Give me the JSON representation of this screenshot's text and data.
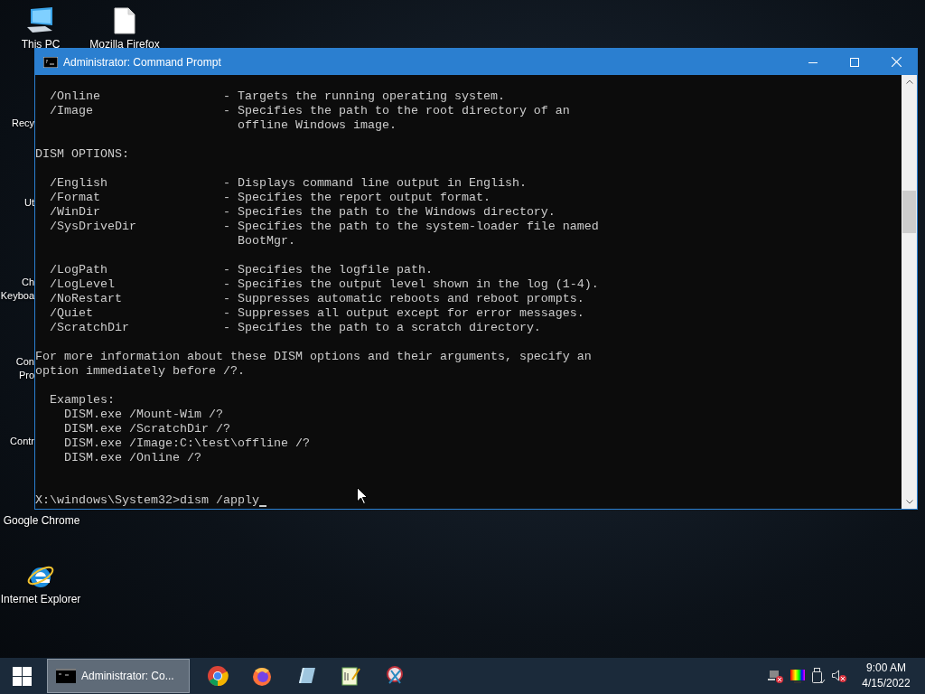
{
  "desktop_icons": [
    {
      "kind": "computer",
      "lines": [
        "This PC"
      ]
    },
    {
      "kind": "file",
      "lines": [
        "Mozilla Firefox"
      ]
    },
    {
      "kind": "hidden",
      "lines": [
        "Recy"
      ]
    },
    {
      "kind": "hidden",
      "lines": [
        "Ut"
      ]
    },
    {
      "kind": "hidden",
      "lines": [
        "Ch",
        "Keyboa"
      ]
    },
    {
      "kind": "hidden",
      "lines": [
        "Con",
        "Pro"
      ]
    },
    {
      "kind": "hidden",
      "lines": [
        "Contr"
      ]
    },
    {
      "kind": "hidden",
      "lines": [
        "Google Chrome"
      ]
    },
    {
      "kind": "ie",
      "lines": [
        "Internet Explorer"
      ]
    }
  ],
  "window": {
    "title": "Administrator: Command Prompt",
    "console_blocks": [
      [
        "  /Online                 - Targets the running operating system.",
        "  /Image                  - Specifies the path to the root directory of an",
        "                            offline Windows image."
      ],
      [
        "DISM OPTIONS:"
      ],
      [
        "  /English                - Displays command line output in English.",
        "  /Format                 - Specifies the report output format.",
        "  /WinDir                 - Specifies the path to the Windows directory.",
        "  /SysDriveDir            - Specifies the path to the system-loader file named",
        "                            BootMgr."
      ],
      [
        "  /LogPath                - Specifies the logfile path.",
        "  /LogLevel               - Specifies the output level shown in the log (1-4).",
        "  /NoRestart              - Suppresses automatic reboots and reboot prompts.",
        "  /Quiet                  - Suppresses all output except for error messages.",
        "  /ScratchDir             - Specifies the path to a scratch directory."
      ],
      [
        "For more information about these DISM options and their arguments, specify an",
        "option immediately before /?."
      ],
      [
        "  Examples:",
        "    DISM.exe /Mount-Wim /?",
        "    DISM.exe /ScratchDir /?",
        "    DISM.exe /Image:C:\\test\\offline /?",
        "    DISM.exe /Online /?"
      ]
    ],
    "prompt": "X:\\windows\\System32>dism /apply"
  },
  "taskbar": {
    "tasks": [
      {
        "label": "Administrator: Co...",
        "selected": true
      }
    ],
    "pinned": [
      {
        "kind": "chrome"
      },
      {
        "kind": "firefox"
      },
      {
        "kind": "tile"
      },
      {
        "kind": "notepad"
      },
      {
        "kind": "snip"
      }
    ],
    "time": "9:00 AM",
    "date": "4/15/2022"
  }
}
